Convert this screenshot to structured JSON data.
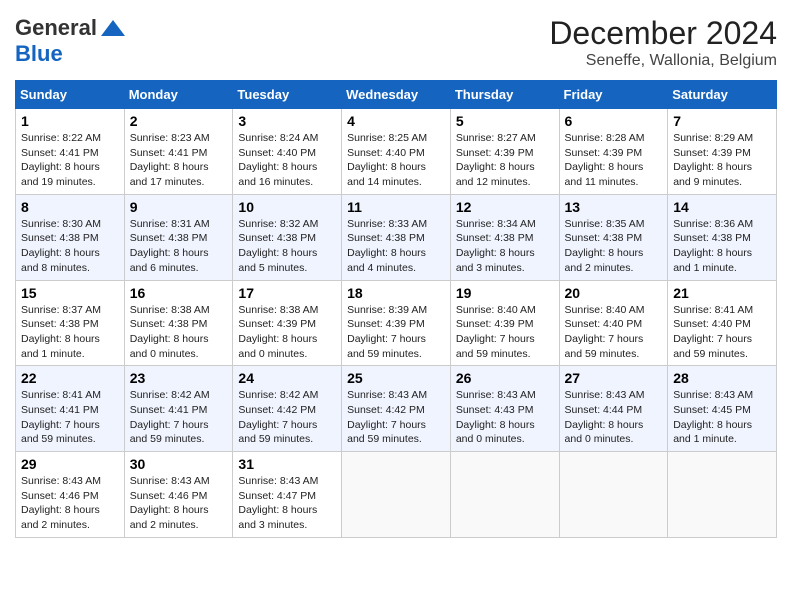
{
  "header": {
    "logo_general": "General",
    "logo_blue": "Blue",
    "month_title": "December 2024",
    "location": "Seneffe, Wallonia, Belgium"
  },
  "weekdays": [
    "Sunday",
    "Monday",
    "Tuesday",
    "Wednesday",
    "Thursday",
    "Friday",
    "Saturday"
  ],
  "weeks": [
    [
      {
        "day": "1",
        "info": "Sunrise: 8:22 AM\nSunset: 4:41 PM\nDaylight: 8 hours and 19 minutes."
      },
      {
        "day": "2",
        "info": "Sunrise: 8:23 AM\nSunset: 4:41 PM\nDaylight: 8 hours and 17 minutes."
      },
      {
        "day": "3",
        "info": "Sunrise: 8:24 AM\nSunset: 4:40 PM\nDaylight: 8 hours and 16 minutes."
      },
      {
        "day": "4",
        "info": "Sunrise: 8:25 AM\nSunset: 4:40 PM\nDaylight: 8 hours and 14 minutes."
      },
      {
        "day": "5",
        "info": "Sunrise: 8:27 AM\nSunset: 4:39 PM\nDaylight: 8 hours and 12 minutes."
      },
      {
        "day": "6",
        "info": "Sunrise: 8:28 AM\nSunset: 4:39 PM\nDaylight: 8 hours and 11 minutes."
      },
      {
        "day": "7",
        "info": "Sunrise: 8:29 AM\nSunset: 4:39 PM\nDaylight: 8 hours and 9 minutes."
      }
    ],
    [
      {
        "day": "8",
        "info": "Sunrise: 8:30 AM\nSunset: 4:38 PM\nDaylight: 8 hours and 8 minutes."
      },
      {
        "day": "9",
        "info": "Sunrise: 8:31 AM\nSunset: 4:38 PM\nDaylight: 8 hours and 6 minutes."
      },
      {
        "day": "10",
        "info": "Sunrise: 8:32 AM\nSunset: 4:38 PM\nDaylight: 8 hours and 5 minutes."
      },
      {
        "day": "11",
        "info": "Sunrise: 8:33 AM\nSunset: 4:38 PM\nDaylight: 8 hours and 4 minutes."
      },
      {
        "day": "12",
        "info": "Sunrise: 8:34 AM\nSunset: 4:38 PM\nDaylight: 8 hours and 3 minutes."
      },
      {
        "day": "13",
        "info": "Sunrise: 8:35 AM\nSunset: 4:38 PM\nDaylight: 8 hours and 2 minutes."
      },
      {
        "day": "14",
        "info": "Sunrise: 8:36 AM\nSunset: 4:38 PM\nDaylight: 8 hours and 1 minute."
      }
    ],
    [
      {
        "day": "15",
        "info": "Sunrise: 8:37 AM\nSunset: 4:38 PM\nDaylight: 8 hours and 1 minute."
      },
      {
        "day": "16",
        "info": "Sunrise: 8:38 AM\nSunset: 4:38 PM\nDaylight: 8 hours and 0 minutes."
      },
      {
        "day": "17",
        "info": "Sunrise: 8:38 AM\nSunset: 4:39 PM\nDaylight: 8 hours and 0 minutes."
      },
      {
        "day": "18",
        "info": "Sunrise: 8:39 AM\nSunset: 4:39 PM\nDaylight: 7 hours and 59 minutes."
      },
      {
        "day": "19",
        "info": "Sunrise: 8:40 AM\nSunset: 4:39 PM\nDaylight: 7 hours and 59 minutes."
      },
      {
        "day": "20",
        "info": "Sunrise: 8:40 AM\nSunset: 4:40 PM\nDaylight: 7 hours and 59 minutes."
      },
      {
        "day": "21",
        "info": "Sunrise: 8:41 AM\nSunset: 4:40 PM\nDaylight: 7 hours and 59 minutes."
      }
    ],
    [
      {
        "day": "22",
        "info": "Sunrise: 8:41 AM\nSunset: 4:41 PM\nDaylight: 7 hours and 59 minutes."
      },
      {
        "day": "23",
        "info": "Sunrise: 8:42 AM\nSunset: 4:41 PM\nDaylight: 7 hours and 59 minutes."
      },
      {
        "day": "24",
        "info": "Sunrise: 8:42 AM\nSunset: 4:42 PM\nDaylight: 7 hours and 59 minutes."
      },
      {
        "day": "25",
        "info": "Sunrise: 8:43 AM\nSunset: 4:42 PM\nDaylight: 7 hours and 59 minutes."
      },
      {
        "day": "26",
        "info": "Sunrise: 8:43 AM\nSunset: 4:43 PM\nDaylight: 8 hours and 0 minutes."
      },
      {
        "day": "27",
        "info": "Sunrise: 8:43 AM\nSunset: 4:44 PM\nDaylight: 8 hours and 0 minutes."
      },
      {
        "day": "28",
        "info": "Sunrise: 8:43 AM\nSunset: 4:45 PM\nDaylight: 8 hours and 1 minute."
      }
    ],
    [
      {
        "day": "29",
        "info": "Sunrise: 8:43 AM\nSunset: 4:46 PM\nDaylight: 8 hours and 2 minutes."
      },
      {
        "day": "30",
        "info": "Sunrise: 8:43 AM\nSunset: 4:46 PM\nDaylight: 8 hours and 2 minutes."
      },
      {
        "day": "31",
        "info": "Sunrise: 8:43 AM\nSunset: 4:47 PM\nDaylight: 8 hours and 3 minutes."
      },
      null,
      null,
      null,
      null
    ]
  ]
}
